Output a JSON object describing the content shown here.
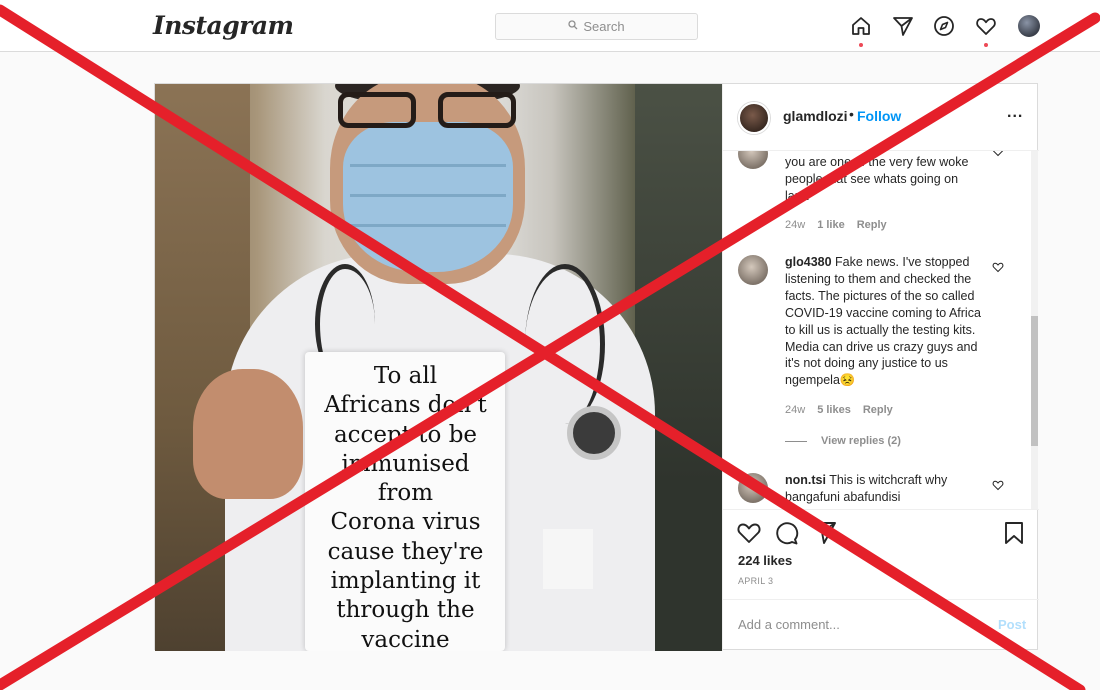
{
  "nav": {
    "logo": "Instagram",
    "search_placeholder": "Search",
    "icons": [
      "home-icon",
      "direct-icon",
      "explore-icon",
      "activity-icon",
      "profile-avatar"
    ]
  },
  "post": {
    "image_sign_lines": [
      "To all",
      "Africans don't",
      "accept to be",
      "immunised",
      "from",
      "Corona virus",
      "cause they're",
      "implanting it",
      "through the",
      "vaccine"
    ],
    "header": {
      "username": "glamdlozi",
      "separator": "•",
      "follow_label": "Follow",
      "more_label": "..."
    },
    "comments": [
      {
        "text": "you are one of the very few woke people that see whats going on lana",
        "time": "24w",
        "likes": "1 like",
        "reply": "Reply"
      },
      {
        "user": "glo4380",
        "text": "Fake news. I've stopped listening to them and checked the facts. The pictures of the so called COVID-19 vaccine coming to Africa to kill us is actually the testing kits. Media can drive us crazy guys and it's not doing any justice to us ngempela😣",
        "time": "24w",
        "likes": "5 likes",
        "reply": "Reply",
        "view_replies": "View replies (2)"
      },
      {
        "user": "non.tsi",
        "text": "This is witchcraft why bangafuni abafundisi"
      }
    ],
    "likes": "224 likes",
    "date": "APRIL 3",
    "add_comment_placeholder": "Add a comment...",
    "post_label": "Post"
  },
  "colors": {
    "accent": "#0095f6",
    "cross": "#e5202a",
    "notification": "#ed4956"
  }
}
